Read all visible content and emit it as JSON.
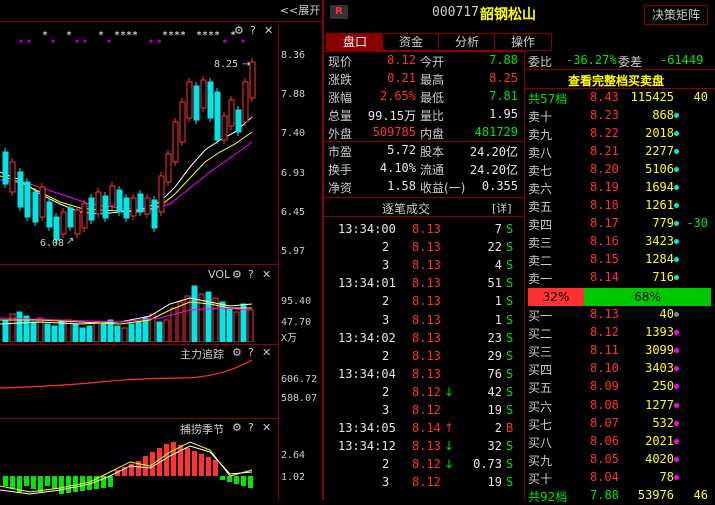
{
  "header": {
    "expand_label": "<<展开",
    "badge": "R",
    "stock_code": "000717",
    "stock_name": "韶钢松山",
    "decision_button": "决策矩阵"
  },
  "tabs": [
    {
      "label": "盘口",
      "active": true
    },
    {
      "label": "资金",
      "active": false
    },
    {
      "label": "分析",
      "active": false
    },
    {
      "label": "操作",
      "active": false
    }
  ],
  "quote": {
    "rows": [
      {
        "l1": "现价",
        "v1": "8.12",
        "c1": "red",
        "l2": "今开",
        "v2": "7.88",
        "c2": "green"
      },
      {
        "l1": "涨跌",
        "v1": "0.21",
        "c1": "red",
        "l2": "最高",
        "v2": "8.25",
        "c2": "red"
      },
      {
        "l1": "涨幅",
        "v1": "2.65%",
        "c1": "red",
        "l2": "最低",
        "v2": "7.81",
        "c2": "green"
      },
      {
        "l1": "总量",
        "v1": "99.15万",
        "c1": "white",
        "l2": "量比",
        "v2": "1.95",
        "c2": "white"
      },
      {
        "l1": "外盘",
        "v1": "509785",
        "c1": "red",
        "l2": "内盘",
        "v2": "481729",
        "c2": "green"
      }
    ],
    "stats": [
      {
        "l1": "市盈",
        "v1": "5.72",
        "l2": "股本",
        "v2": "24.20亿"
      },
      {
        "l1": "换手",
        "v1": "4.10%",
        "l2": "流通",
        "v2": "24.20亿"
      },
      {
        "l1": "净资",
        "v1": "1.58",
        "l2": "收益(一)",
        "v2": "0.355"
      }
    ]
  },
  "ticks": {
    "title": "逐笔成交",
    "detail": "[详]",
    "rows": [
      {
        "time": "13:34:00",
        "price": "8.13",
        "arrow": "",
        "vol": "7",
        "side": "S"
      },
      {
        "time": "2",
        "price": "8.13",
        "arrow": "",
        "vol": "22",
        "side": "S"
      },
      {
        "time": "3",
        "price": "8.13",
        "arrow": "",
        "vol": "4",
        "side": "S"
      },
      {
        "time": "13:34:01",
        "price": "8.13",
        "arrow": "",
        "vol": "51",
        "side": "S"
      },
      {
        "time": "2",
        "price": "8.13",
        "arrow": "",
        "vol": "1",
        "side": "S"
      },
      {
        "time": "3",
        "price": "8.13",
        "arrow": "",
        "vol": "1",
        "side": "S"
      },
      {
        "time": "13:34:02",
        "price": "8.13",
        "arrow": "",
        "vol": "23",
        "side": "S"
      },
      {
        "time": "2",
        "price": "8.13",
        "arrow": "",
        "vol": "29",
        "side": "S"
      },
      {
        "time": "13:34:04",
        "price": "8.13",
        "arrow": "",
        "vol": "76",
        "side": "S"
      },
      {
        "time": "2",
        "price": "8.12",
        "arrow": "↓",
        "vol": "42",
        "side": "S"
      },
      {
        "time": "3",
        "price": "8.12",
        "arrow": "",
        "vol": "19",
        "side": "S"
      },
      {
        "time": "13:34:05",
        "price": "8.14",
        "arrow": "↑",
        "vol": "2",
        "side": "B"
      },
      {
        "time": "13:34:12",
        "price": "8.13",
        "arrow": "↓",
        "vol": "32",
        "side": "S"
      },
      {
        "time": "2",
        "price": "8.12",
        "arrow": "↓",
        "vol": "0.73",
        "side": "S"
      },
      {
        "time": "3",
        "price": "8.12",
        "arrow": "",
        "vol": "19",
        "side": "S"
      }
    ]
  },
  "orderbook": {
    "weibi_label": "委比",
    "weibi_value": "-36.27%",
    "weicha_label": "委差",
    "weicha_value": "-61449",
    "full_link": "查看完整档买卖盘",
    "total_sell": {
      "label": "共57档",
      "price": "8.43",
      "vol": "115425",
      "extra": "40"
    },
    "sells": [
      {
        "label": "卖十",
        "price": "8.23",
        "vol": "868",
        "dot": "cyan",
        "extra": ""
      },
      {
        "label": "卖九",
        "price": "8.22",
        "vol": "2018",
        "dot": "cyan",
        "extra": ""
      },
      {
        "label": "卖八",
        "price": "8.21",
        "vol": "2277",
        "dot": "cyan",
        "extra": ""
      },
      {
        "label": "卖七",
        "price": "8.20",
        "vol": "5106",
        "dot": "cyan",
        "extra": ""
      },
      {
        "label": "卖六",
        "price": "8.19",
        "vol": "1694",
        "dot": "cyan",
        "extra": ""
      },
      {
        "label": "卖五",
        "price": "8.18",
        "vol": "1261",
        "dot": "cyan",
        "extra": ""
      },
      {
        "label": "卖四",
        "price": "8.17",
        "vol": "779",
        "dot": "cyan",
        "extra": "-30"
      },
      {
        "label": "卖三",
        "price": "8.16",
        "vol": "3423",
        "dot": "cyan",
        "extra": ""
      },
      {
        "label": "卖二",
        "price": "8.15",
        "vol": "1284",
        "dot": "cyan",
        "extra": ""
      },
      {
        "label": "卖一",
        "price": "8.14",
        "vol": "716",
        "dot": "cyan",
        "extra": ""
      }
    ],
    "ratio_sell": "32%",
    "ratio_buy": "68%",
    "ratio_sell_fraction": 0.32,
    "buys": [
      {
        "label": "买一",
        "price": "8.13",
        "vol": "40",
        "dot": "gray"
      },
      {
        "label": "买二",
        "price": "8.12",
        "vol": "1393",
        "dot": "magenta"
      },
      {
        "label": "买三",
        "price": "8.11",
        "vol": "3099",
        "dot": "magenta"
      },
      {
        "label": "买四",
        "price": "8.10",
        "vol": "3403",
        "dot": "magenta"
      },
      {
        "label": "买五",
        "price": "8.09",
        "vol": "250",
        "dot": "magenta"
      },
      {
        "label": "买六",
        "price": "8.08",
        "vol": "1277",
        "dot": "magenta"
      },
      {
        "label": "买七",
        "price": "8.07",
        "vol": "532",
        "dot": "magenta"
      },
      {
        "label": "买八",
        "price": "8.06",
        "vol": "2021",
        "dot": "magenta"
      },
      {
        "label": "买九",
        "price": "8.05",
        "vol": "4020",
        "dot": "magenta"
      },
      {
        "label": "买十",
        "price": "8.04",
        "vol": "78",
        "dot": "magenta"
      }
    ],
    "total_buy": {
      "label": "共92档",
      "price": "7.88",
      "vol": "53976",
      "extra": "46"
    }
  },
  "chart_panels": {
    "main_axis": [
      "8.36",
      "7.88",
      "7.40",
      "6.93",
      "6.45",
      "5.97"
    ],
    "high_marker": "8.25",
    "low_marker": "6.08",
    "vol_title": "VOL",
    "vol_axis": [
      "95.40",
      "47.70",
      "X万"
    ],
    "zhuli_title": "主力追踪",
    "zhuli_axis": [
      "606.72",
      "588.07"
    ],
    "buhuo_title": "捕捞季节",
    "buhuo_axis": [
      "2.64",
      "1.02"
    ]
  },
  "colors": {
    "up": "#ff3232",
    "down": "#00e6e6",
    "frame": "#8b0000",
    "buy_bar": "#00c800"
  }
}
